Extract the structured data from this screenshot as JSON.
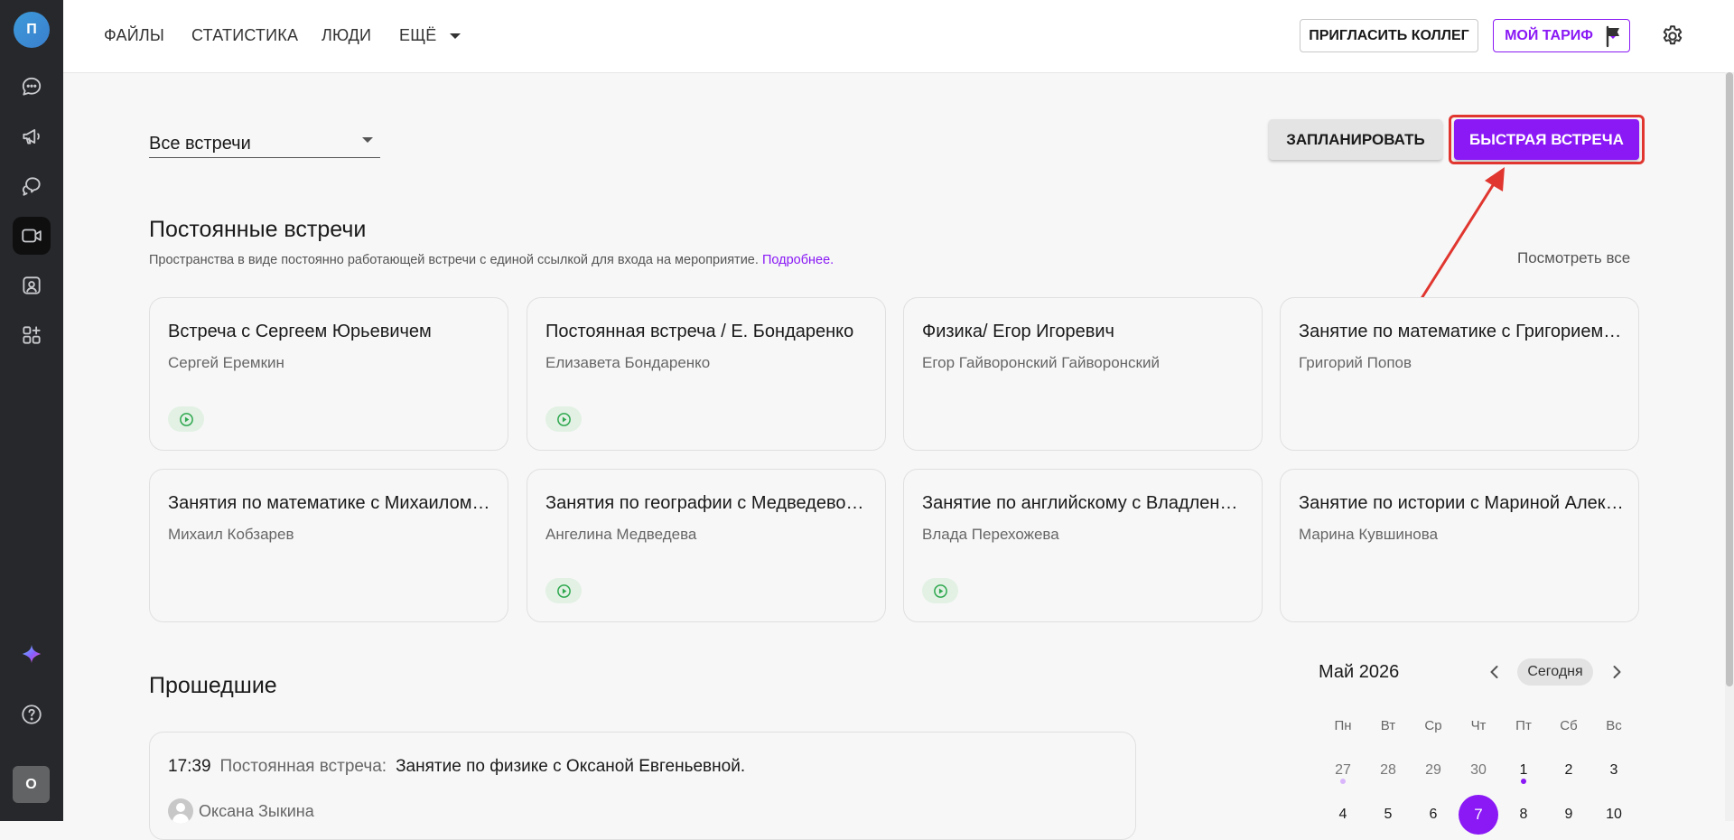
{
  "rail": {
    "avatar_letter": "П",
    "bottom_avatar_letter": "О",
    "items": [
      "chat-icon",
      "megaphone-icon",
      "threads-icon",
      "video-icon",
      "contact-card-icon",
      "apps-icon",
      "sparkle-icon",
      "help-icon"
    ],
    "active_item": "video-icon"
  },
  "topbar": {
    "nav": [
      "ФАЙЛЫ",
      "СТАТИСТИКА",
      "ЛЮДИ",
      "ЕЩЁ"
    ],
    "invite_label": "ПРИГЛАСИТЬ КОЛЛЕГ",
    "tariff_label": "МОЙ ТАРИФ",
    "icons": [
      "flag-icon",
      "gear-icon"
    ]
  },
  "filter": {
    "selected": "Все встречи"
  },
  "actions": {
    "plan_label": "ЗАПЛАНИРОВАТЬ",
    "quick_label": "БЫСТРАЯ ВСТРЕЧА"
  },
  "permanent": {
    "title": "Постоянные встречи",
    "description": "Пространства в виде постоянно работающей встречи с единой ссылкой для входа на мероприятие.",
    "more_link": "Подробнее.",
    "see_all": "Посмотреть все",
    "cards": [
      {
        "title": "Встреча с Сергеем Юрьевичем",
        "owner": "Сергей Еремкин",
        "live": true
      },
      {
        "title": "Постоянная встреча / Е. Бондаренко",
        "owner": "Елизавета Бондаренко",
        "live": true
      },
      {
        "title": "Физика/ Егор Игоревич",
        "owner": "Егор Гайворонский Гайворонский",
        "live": false
      },
      {
        "title": "Занятие по математике с Григорием Поповым",
        "owner": "Григорий Попов",
        "live": false
      },
      {
        "title": "Занятия по математике с Михаилом Кобзаревым",
        "owner": "Михаил Кобзарев",
        "live": false
      },
      {
        "title": "Занятия по географии с Медведевой Ангелиной",
        "owner": "Ангелина Медведева",
        "live": true
      },
      {
        "title": "Занятие по английскому с Владленой Перехожевой",
        "owner": "Влада Перехожева",
        "live": true
      },
      {
        "title": "Занятие по истории с Мариной Алексеевной",
        "owner": "Марина Кувшинова",
        "live": false
      }
    ]
  },
  "past": {
    "title": "Прошедшие",
    "items": [
      {
        "time": "17:39",
        "kind": "Постоянная встреча:",
        "name": "Занятие по физике с Оксаной Евгеньевной.",
        "person": "Оксана Зыкина"
      }
    ]
  },
  "calendar": {
    "month": "Май 2026",
    "today_label": "Сегодня",
    "weekdays": [
      "Пн",
      "Вт",
      "Ср",
      "Чт",
      "Пт",
      "Сб",
      "Вс"
    ],
    "week1": [
      "27",
      "28",
      "29",
      "30",
      "1",
      "2",
      "3"
    ],
    "week2": [
      "4",
      "5",
      "6",
      "7",
      "8",
      "9",
      "10"
    ],
    "selected_day": "7",
    "dot_colors": {
      "muted": "#d9b6fb",
      "accent": "#8a19f5"
    }
  },
  "colors": {
    "accent": "#8a19f5",
    "highlight": "#e0362f",
    "live_green": "#2fa84f"
  }
}
